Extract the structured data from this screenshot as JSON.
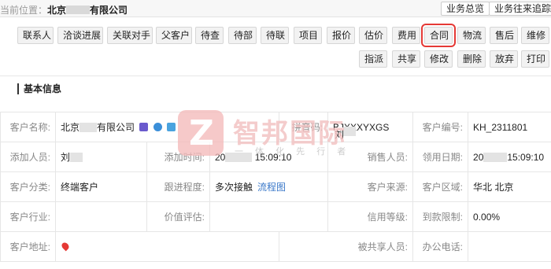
{
  "breadcrumb": {
    "prefix": "当前位置：",
    "company_start": "北京",
    "company_end": "有限公司"
  },
  "top_actions": [
    "业务总览",
    "业务往来追踪"
  ],
  "toolbar_row1": [
    "联系人",
    "洽谈进展",
    "关联对手",
    "父客户",
    "待查",
    "待部",
    "待联",
    "项目",
    "报价",
    "估价",
    "费用",
    "合同",
    "物流",
    "售后",
    "维修"
  ],
  "toolbar_row2": [
    "指派",
    "共享",
    "修改",
    "删除",
    "放弃",
    "打印"
  ],
  "highlighted_button": "合同",
  "section_title": "基本信息",
  "fields": {
    "customer_name_label": "客户名称:",
    "customer_name_start": "北京",
    "customer_name_end": "有限公司",
    "pinyin_label": "拼音码:",
    "pinyin_value": "BJXXXYXGS",
    "customer_no_label": "客户编号:",
    "customer_no_value": "KH_2311801",
    "added_by_label": "添加人员:",
    "added_by_value": "刘",
    "added_time_label": "添加时间:",
    "added_time_date": "20",
    "added_time_time": "15:09:10",
    "sales_label": "销售人员:",
    "sales_value": "刘",
    "claim_date_label": "领用日期:",
    "claim_date_date": "20",
    "claim_date_time": "15:09:10",
    "category_label": "客户分类:",
    "category_value": "终端客户",
    "progress_label": "跟进程度:",
    "progress_value": "多次接触",
    "progress_link": "流程图",
    "source_label": "客户来源:",
    "source_value": "",
    "region_label": "客户区域:",
    "region_value": "华北 北京",
    "industry_label": "客户行业:",
    "industry_value": "",
    "value_label": "价值评估:",
    "value_value": "",
    "credit_label": "信用等级:",
    "credit_value": "",
    "payment_limit_label": "到款限制:",
    "payment_limit_value": "0.00%",
    "address_label": "客户地址:",
    "address_value": "",
    "shared_label": "被共享人员:",
    "shared_value": "",
    "office_phone_label": "办公电话:",
    "office_phone_value": ""
  },
  "watermark": {
    "logo_letter": "Z",
    "title": "智邦国际",
    "subtitle": "一 体 化 先 行 者"
  },
  "colors": {
    "highlight": "#e53935",
    "link": "#3a78c9",
    "icon_purple": "#6a5acd",
    "icon_blue": "#3b8fd9",
    "icon_lightblue": "#4aa3df"
  }
}
